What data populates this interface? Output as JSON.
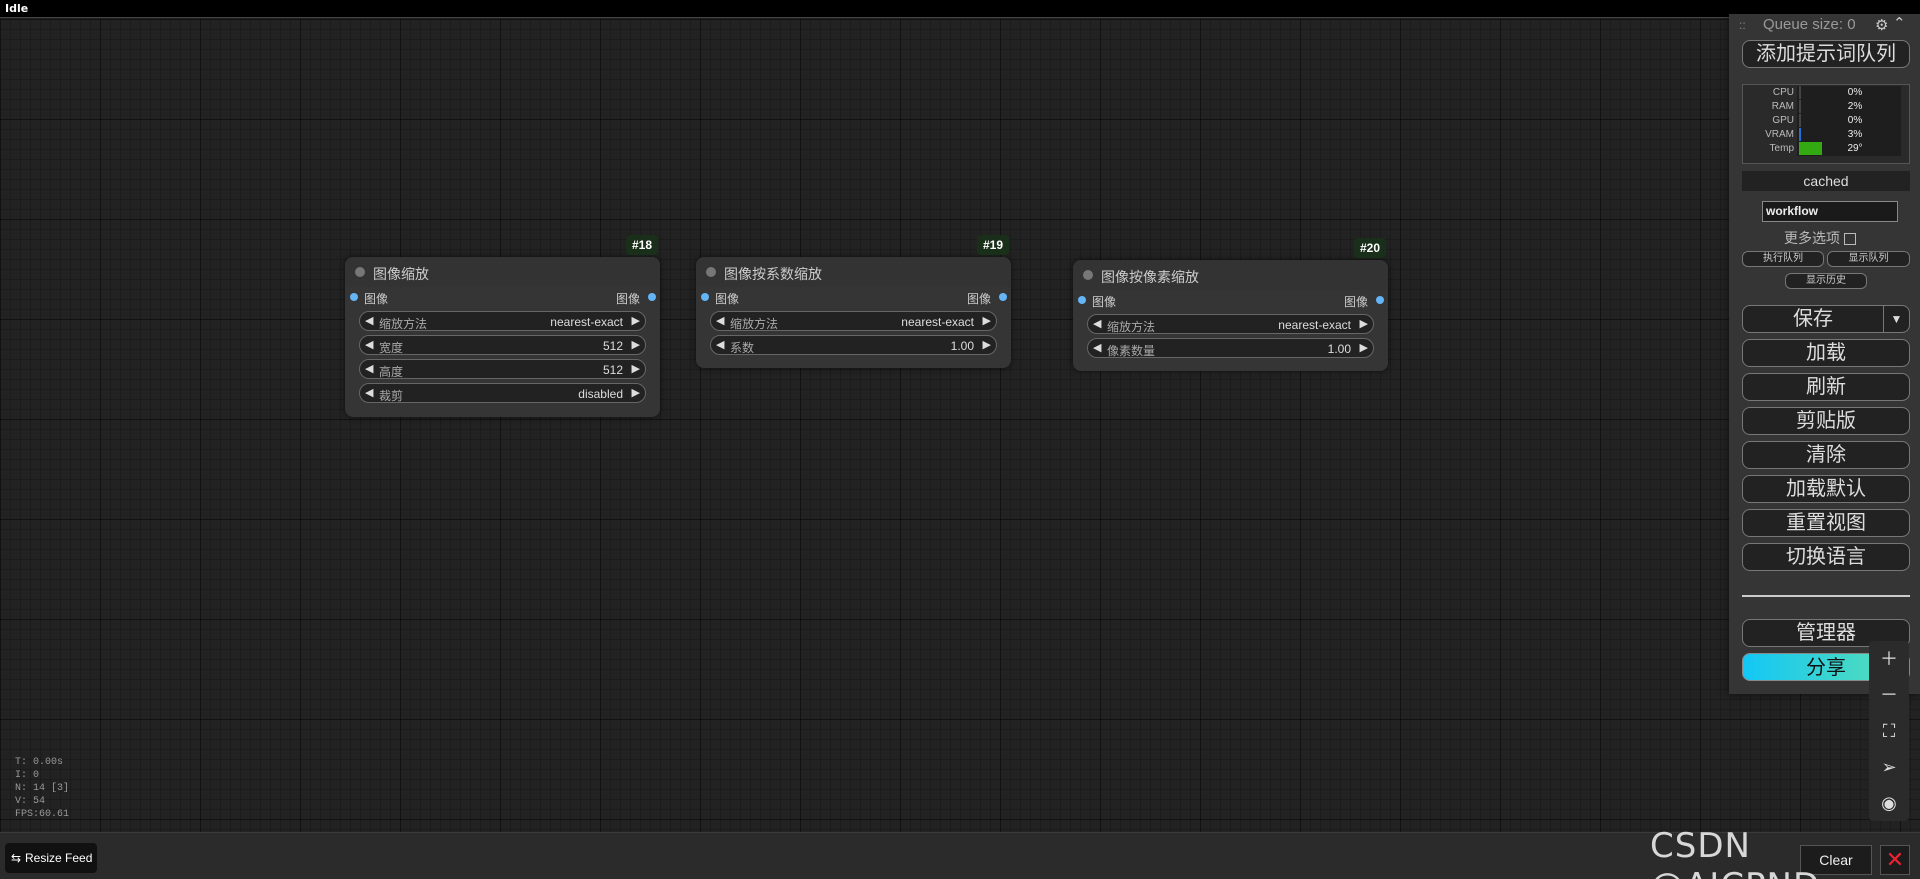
{
  "status": {
    "text": "Idle"
  },
  "nodes": [
    {
      "id": "#18",
      "title": "图像缩放",
      "input": "图像",
      "output": "图像",
      "widgets": [
        {
          "label": "缩放方法",
          "value": "nearest-exact"
        },
        {
          "label": "宽度",
          "value": "512"
        },
        {
          "label": "高度",
          "value": "512"
        },
        {
          "label": "裁剪",
          "value": "disabled"
        }
      ]
    },
    {
      "id": "#19",
      "title": "图像按系数缩放",
      "input": "图像",
      "output": "图像",
      "widgets": [
        {
          "label": "缩放方法",
          "value": "nearest-exact"
        },
        {
          "label": "系数",
          "value": "1.00"
        }
      ]
    },
    {
      "id": "#20",
      "title": "图像按像素缩放",
      "input": "图像",
      "output": "图像",
      "widgets": [
        {
          "label": "缩放方法",
          "value": "nearest-exact"
        },
        {
          "label": "像素数量",
          "value": "1.00"
        }
      ]
    }
  ],
  "stats": {
    "t": "T: 0.00s",
    "i": "I: 0",
    "n": "N: 14 [3]",
    "v": "V: 54",
    "fps": "FPS:60.61"
  },
  "bottom": {
    "resize_feed": "Resize Feed",
    "clear": "Clear",
    "close": "✕",
    "watermark": "CSDN @AICPND"
  },
  "menu": {
    "grip": "::",
    "queue_size": "Queue size: 0",
    "add_queue": "添加提示词队列",
    "monitor": [
      {
        "key": "CPU",
        "value": "0%",
        "level": 0.0,
        "color": "#444444"
      },
      {
        "key": "RAM",
        "value": "2%",
        "level": 0.02,
        "color": "#444444"
      },
      {
        "key": "GPU",
        "value": "0%",
        "level": 0.0,
        "color": "#444444"
      },
      {
        "key": "VRAM",
        "value": "3%",
        "level": 0.03,
        "color": "#1e6fd6"
      },
      {
        "key": "Temp",
        "value": "29°",
        "level": 0.29,
        "color": "#33aa11"
      }
    ],
    "cached": "cached",
    "workflow_name": "workflow",
    "more_options": "更多选项",
    "execute_queue": "执行队列",
    "show_queue": "显示队列",
    "show_history": "显示历史",
    "save": "保存",
    "load": "加载",
    "refresh": "刷新",
    "clipspace": "剪贴版",
    "clear": "清除",
    "load_default": "加载默认",
    "reset_view": "重置视图",
    "switch_language": "切换语言",
    "manager": "管理器",
    "share": "分享"
  },
  "canvas_tools": [
    "zoom-in",
    "zoom-out",
    "fit-view",
    "locate",
    "toggle-visibility"
  ]
}
